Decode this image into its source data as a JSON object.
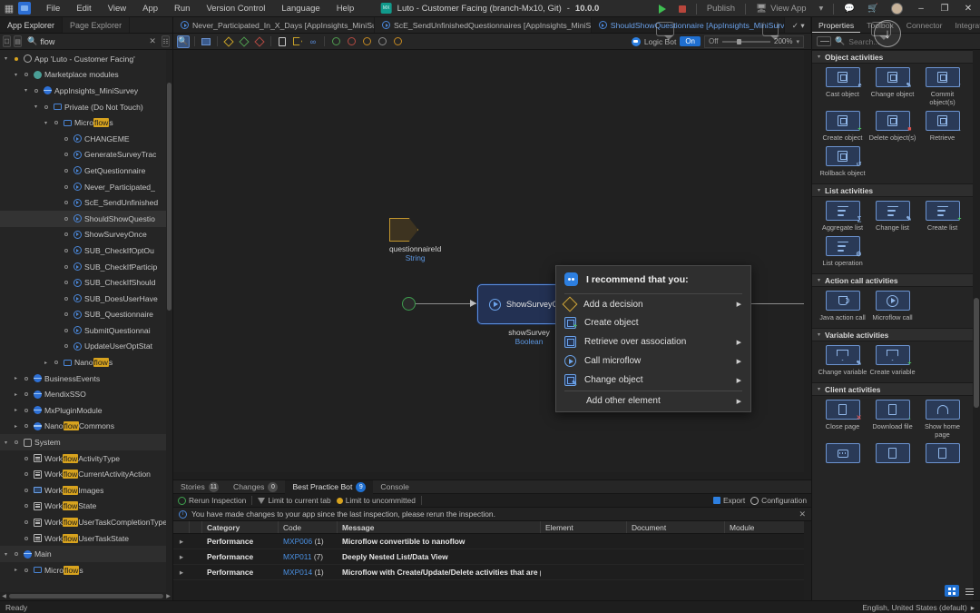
{
  "window": {
    "title": "Luto - Customer Facing (branch-Mx10, Git)",
    "version": "10.0.0",
    "logo_text": "MX",
    "menus": [
      "File",
      "Edit",
      "View",
      "App",
      "Run",
      "Version Control",
      "Language",
      "Help"
    ],
    "run_label": "Run",
    "publish_label": "Publish",
    "view_app_label": "View App",
    "minimize": "–",
    "maximize": "❐",
    "close": "✕"
  },
  "explorer": {
    "tabs": [
      {
        "label": "App Explorer",
        "active": true
      },
      {
        "label": "Page Explorer",
        "active": false
      }
    ],
    "search": {
      "value": "flow",
      "placeholder": "Search",
      "clear": "✕"
    },
    "tree": [
      {
        "indent": 0,
        "chev": "▾",
        "bullet": "amber",
        "icon": "app-icon",
        "pre": "App 'Luto - Customer Facing'",
        "hl": "",
        "post": ""
      },
      {
        "indent": 1,
        "chev": "▾",
        "bullet": "plain",
        "icon": "market-icon",
        "pre": "Marketplace modules",
        "hl": "",
        "post": ""
      },
      {
        "indent": 2,
        "chev": "▾",
        "bullet": "plain",
        "icon": "module-icon",
        "pre": "AppInsights_MiniSurvey",
        "hl": "",
        "post": ""
      },
      {
        "indent": 3,
        "chev": "▾",
        "bullet": "plain",
        "icon": "folder-icon",
        "pre": "Private (Do Not Touch)",
        "hl": "",
        "post": ""
      },
      {
        "indent": 4,
        "chev": "▾",
        "bullet": "plain",
        "icon": "folder-icon",
        "pre": "Micro",
        "hl": "flow",
        "post": "s"
      },
      {
        "indent": 5,
        "chev": "",
        "bullet": "plain",
        "icon": "mf-icon",
        "pre": "CHANGEME",
        "hl": "",
        "post": ""
      },
      {
        "indent": 5,
        "chev": "",
        "bullet": "plain",
        "icon": "mf-icon",
        "pre": "GenerateSurveyTrac",
        "hl": "",
        "post": ""
      },
      {
        "indent": 5,
        "chev": "",
        "bullet": "plain",
        "icon": "mf-icon",
        "pre": "GetQuestionnaire",
        "hl": "",
        "post": ""
      },
      {
        "indent": 5,
        "chev": "",
        "bullet": "plain",
        "icon": "mf-icon",
        "pre": "Never_Participated_",
        "hl": "",
        "post": ""
      },
      {
        "indent": 5,
        "chev": "",
        "bullet": "plain",
        "icon": "mf-icon",
        "pre": "ScE_SendUnfinished",
        "hl": "",
        "post": ""
      },
      {
        "indent": 5,
        "chev": "",
        "bullet": "plain",
        "icon": "mf-icon",
        "pre": "ShouldShowQuestio",
        "hl": "",
        "post": "",
        "selected": true
      },
      {
        "indent": 5,
        "chev": "",
        "bullet": "plain",
        "icon": "mf-icon",
        "pre": "ShowSurveyOnce",
        "hl": "",
        "post": ""
      },
      {
        "indent": 5,
        "chev": "",
        "bullet": "plain",
        "icon": "mf-icon",
        "pre": "SUB_CheckIfOptOu",
        "hl": "",
        "post": ""
      },
      {
        "indent": 5,
        "chev": "",
        "bullet": "plain",
        "icon": "mf-icon",
        "pre": "SUB_CheckIfParticip",
        "hl": "",
        "post": ""
      },
      {
        "indent": 5,
        "chev": "",
        "bullet": "plain",
        "icon": "mf-icon",
        "pre": "SUB_CheckIfShould",
        "hl": "",
        "post": ""
      },
      {
        "indent": 5,
        "chev": "",
        "bullet": "plain",
        "icon": "mf-icon",
        "pre": "SUB_DoesUserHave",
        "hl": "",
        "post": ""
      },
      {
        "indent": 5,
        "chev": "",
        "bullet": "plain",
        "icon": "mf-icon",
        "pre": "SUB_Questionnaire",
        "hl": "",
        "post": ""
      },
      {
        "indent": 5,
        "chev": "",
        "bullet": "plain",
        "icon": "mf-icon",
        "pre": "SubmitQuestionnai",
        "hl": "",
        "post": ""
      },
      {
        "indent": 5,
        "chev": "",
        "bullet": "plain",
        "icon": "mf-icon",
        "pre": "UpdateUserOptStat",
        "hl": "",
        "post": ""
      },
      {
        "indent": 4,
        "chev": "▸",
        "bullet": "plain",
        "icon": "folder-icon",
        "pre": "Nano",
        "hl": "flow",
        "post": "s"
      },
      {
        "indent": 1,
        "chev": "▸",
        "bullet": "plain",
        "icon": "module-icon",
        "pre": "BusinessEvents",
        "hl": "",
        "post": ""
      },
      {
        "indent": 1,
        "chev": "▸",
        "bullet": "plain",
        "icon": "module-icon",
        "pre": "MendixSSO",
        "hl": "",
        "post": ""
      },
      {
        "indent": 1,
        "chev": "▸",
        "bullet": "plain",
        "icon": "module-icon",
        "pre": "MxPluginModule",
        "hl": "",
        "post": ""
      },
      {
        "indent": 1,
        "chev": "▸",
        "bullet": "plain",
        "icon": "module-icon",
        "pre": "Nano",
        "hl": "flow",
        "post": "Commons"
      },
      {
        "indent": 0,
        "chev": "▾",
        "bullet": "plain",
        "icon": "system-icon",
        "pre": "System",
        "hl": "",
        "post": "",
        "header": true
      },
      {
        "indent": 1,
        "chev": "",
        "bullet": "plain",
        "icon": "enum-icon",
        "pre": "Work",
        "hl": "flow",
        "post": "ActivityType"
      },
      {
        "indent": 1,
        "chev": "",
        "bullet": "plain",
        "icon": "enum-icon",
        "pre": "Work",
        "hl": "flow",
        "post": "CurrentActivityAction"
      },
      {
        "indent": 1,
        "chev": "",
        "bullet": "plain",
        "icon": "image-icon",
        "pre": "Work",
        "hl": "flow",
        "post": "Images"
      },
      {
        "indent": 1,
        "chev": "",
        "bullet": "plain",
        "icon": "enum-icon",
        "pre": "Work",
        "hl": "flow",
        "post": "State"
      },
      {
        "indent": 1,
        "chev": "",
        "bullet": "plain",
        "icon": "enum-icon",
        "pre": "Work",
        "hl": "flow",
        "post": "UserTaskCompletionType"
      },
      {
        "indent": 1,
        "chev": "",
        "bullet": "plain",
        "icon": "enum-icon",
        "pre": "Work",
        "hl": "flow",
        "post": "UserTaskState"
      },
      {
        "indent": 0,
        "chev": "▾",
        "bullet": "plain",
        "icon": "module-icon",
        "pre": "Main",
        "hl": "",
        "post": "",
        "header": true
      },
      {
        "indent": 1,
        "chev": "▸",
        "bullet": "plain",
        "icon": "folder-icon",
        "pre": "Micro",
        "hl": "flow",
        "post": "s"
      }
    ]
  },
  "doc_tabs": [
    {
      "label": "Never_Participated_In_X_Days [AppInsights_MiniSurvey]",
      "active": false
    },
    {
      "label": "ScE_SendUnfinishedQuestionnaires [AppInsights_MiniSurvey]",
      "active": false
    },
    {
      "label": "ShouldShowQuestionnaire [AppInsights_MiniSurvey]",
      "active": true
    }
  ],
  "editor_toolbar": {
    "logic_bot_label": "Logic Bot",
    "logic_bot_state": "On",
    "zoom_value": "200%",
    "zoom_off": "Off"
  },
  "canvas": {
    "parameter": {
      "name": "questionnaireId",
      "type": "String"
    },
    "activity": {
      "label": "ShowSurveyOnce"
    },
    "activity_caption": {
      "name": "showSurvey",
      "type": "Boolean"
    },
    "hidden_caption": {
      "name": "showSurvey",
      "type": "Boolean"
    }
  },
  "context_menu": {
    "header": "I recommend that you:",
    "items": [
      {
        "label": "Add a decision",
        "icon": "decision-icon",
        "submenu": true
      },
      {
        "label": "Create object",
        "icon": "create-object-icon",
        "submenu": false
      },
      {
        "label": "Retrieve over association",
        "icon": "retrieve-icon",
        "submenu": true
      },
      {
        "label": "Call microflow",
        "icon": "microflow-icon",
        "submenu": true
      },
      {
        "label": "Change object",
        "icon": "change-object-icon",
        "submenu": true
      }
    ],
    "other": {
      "label": "Add other element",
      "submenu": true
    }
  },
  "bottom_panel": {
    "tabs": [
      {
        "label": "Stories",
        "count": "11",
        "active": false,
        "blue": false
      },
      {
        "label": "Changes",
        "count": "0",
        "active": false,
        "blue": false
      },
      {
        "label": "Best Practice Bot",
        "count": "9",
        "active": true,
        "blue": true
      },
      {
        "label": "Console",
        "count": "",
        "active": false,
        "blue": false
      }
    ],
    "actions": [
      {
        "label": "Rerun Inspection",
        "icon": "rerun-icon"
      },
      {
        "label": "Limit to current tab",
        "icon": "filter-icon"
      },
      {
        "label": "Limit to uncommitted",
        "icon": "uncommitted-icon"
      }
    ],
    "right_actions": [
      {
        "label": "Export",
        "icon": "export-icon"
      },
      {
        "label": "Configuration",
        "icon": "configuration-icon"
      }
    ],
    "info": {
      "text": "You have made changes to your app since the last inspection, please rerun the inspection.",
      "close": "✕"
    },
    "columns": [
      "",
      "",
      "Category",
      "Code",
      "Message",
      "Element",
      "Document",
      "Module"
    ],
    "rows": [
      {
        "expand": "▸",
        "category": "Performance",
        "code": "MXP006",
        "count": "(1)",
        "message": "Microflow convertible to nanoflow",
        "element": "",
        "document": "",
        "module": ""
      },
      {
        "expand": "▸",
        "category": "Performance",
        "code": "MXP011",
        "count": "(7)",
        "message": "Deeply Nested List/Data View",
        "element": "",
        "document": "",
        "module": ""
      },
      {
        "expand": "▸",
        "category": "Performance",
        "code": "MXP014",
        "count": "(1)",
        "message": "Microflow with Create/Update/Delete activities that are placed too",
        "element": "",
        "document": "",
        "module": ""
      }
    ]
  },
  "right_panel": {
    "tabs": [
      {
        "label": "Properties",
        "active": true
      },
      {
        "label": "Toolbox",
        "active": false
      },
      {
        "label": "Connector",
        "active": false
      },
      {
        "label": "Integration",
        "active": false
      }
    ],
    "search": {
      "value": "",
      "placeholder": "Search..."
    },
    "groups": [
      {
        "title": "Object activities",
        "items": [
          {
            "label": "Cast object",
            "icon": "cast-object-icon",
            "badge": "e",
            "badge_color": "#8fb6e8"
          },
          {
            "label": "Change object",
            "icon": "change-object-icon",
            "badge": "✎",
            "badge_color": "#8fb6e8"
          },
          {
            "label": "Commit object(s)",
            "icon": "commit-object-icon",
            "badge": "↑",
            "badge_color": "#8fb6e8"
          },
          {
            "label": "Create object",
            "icon": "create-object-icon",
            "badge": "+",
            "badge_color": "#4fbf5f"
          },
          {
            "label": "Delete object(s)",
            "icon": "delete-object-icon",
            "badge": "■",
            "badge_color": "#d9544f"
          },
          {
            "label": "Retrieve",
            "icon": "retrieve-icon",
            "badge": "↓",
            "badge_color": "#8fb6e8"
          },
          {
            "label": "Rollback object",
            "icon": "rollback-object-icon",
            "badge": "↺",
            "badge_color": "#8fb6e8"
          }
        ]
      },
      {
        "title": "List activities",
        "items": [
          {
            "label": "Aggregate list",
            "icon": "aggregate-list-icon",
            "badge": "∑",
            "badge_color": "#8fb6e8"
          },
          {
            "label": "Change list",
            "icon": "change-list-icon",
            "badge": "✎",
            "badge_color": "#8fb6e8"
          },
          {
            "label": "Create list",
            "icon": "create-list-icon",
            "badge": "+",
            "badge_color": "#4fbf5f"
          },
          {
            "label": "List operation",
            "icon": "list-operation-icon",
            "badge": "⚙",
            "badge_color": "#8fb6e8"
          }
        ]
      },
      {
        "title": "Action call activities",
        "items": [
          {
            "label": "Java action call",
            "icon": "java-action-call-icon",
            "badge": "",
            "badge_color": "#8fb6e8"
          },
          {
            "label": "Microflow call",
            "icon": "microflow-call-icon",
            "badge": "",
            "badge_color": "#8fb6e8"
          }
        ]
      },
      {
        "title": "Variable activities",
        "items": [
          {
            "label": "Change variable",
            "icon": "change-variable-icon",
            "badge": "✎",
            "badge_color": "#8fb6e8"
          },
          {
            "label": "Create variable",
            "icon": "create-variable-icon",
            "badge": "+",
            "badge_color": "#4fbf5f"
          }
        ]
      },
      {
        "title": "Client activities",
        "items": [
          {
            "label": "Close page",
            "icon": "close-page-icon",
            "badge": "✕",
            "badge_color": "#d9544f"
          },
          {
            "label": "Download file",
            "icon": "download-file-icon",
            "badge": "↓",
            "badge_color": "#4fbf5f"
          },
          {
            "label": "Show home page",
            "icon": "show-home-page-icon",
            "badge": "",
            "badge_color": "#8fb6e8"
          },
          {
            "label": "",
            "icon": "show-message-icon",
            "badge": "",
            "badge_color": "#8fb6e8"
          },
          {
            "label": "",
            "icon": "show-page-icon",
            "badge": "",
            "badge_color": "#8fb6e8"
          },
          {
            "label": "",
            "icon": "validation-feedback-icon",
            "badge": "",
            "badge_color": "#8fb6e8"
          }
        ]
      }
    ]
  },
  "status_bar": {
    "left": "Ready",
    "right": "English, United States (default)",
    "right_caret": "▸"
  }
}
